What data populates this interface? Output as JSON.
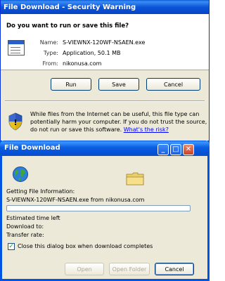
{
  "security_dialog": {
    "title": "File Download - Security Warning",
    "question": "Do you want to run or save this file?",
    "fields": [
      {
        "label": "Name:",
        "value": "S-VIEWNX-120WF-NSAEN.exe"
      },
      {
        "label": "Type:",
        "value": "Application, 50.1 MB"
      },
      {
        "label": "From:",
        "value": "nikonusa.com"
      }
    ],
    "buttons": {
      "run": "Run",
      "save": "Save",
      "cancel": "Cancel"
    },
    "warning_text": "While files from the Internet can be useful, this file type can potentially harm your computer. If you do not trust the source, do not run or save this software.",
    "risk_link": "What's the risk?"
  },
  "download_dialog": {
    "title": "File Download",
    "status": "Getting File Information:",
    "file_line": "S-VIEWNX-120WF-NSAEN.exe from nikonusa.com",
    "estimated_time_label": "Estimated time left",
    "download_to_label": "Download to:",
    "transfer_rate_label": "Transfer rate:",
    "progress_fraction": 0,
    "close_checkbox": {
      "label": "Close this dialog box when download completes",
      "checked": true,
      "mark": "✓"
    },
    "buttons": {
      "open": "Open",
      "open_folder": "Open Folder",
      "cancel": "Cancel"
    },
    "caption_buttons": {
      "minimize": "_",
      "maximize": "□",
      "close": "✕"
    }
  }
}
